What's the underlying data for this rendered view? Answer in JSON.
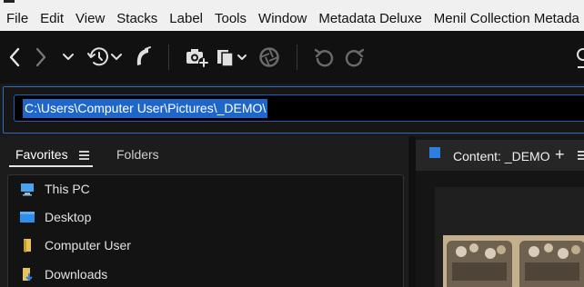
{
  "menubar": {
    "items": [
      "File",
      "Edit",
      "View",
      "Stacks",
      "Label",
      "Tools",
      "Window",
      "Metadata Deluxe",
      "Menil Collection Metada"
    ]
  },
  "toolbar": {
    "buttons": [
      {
        "name": "back-button",
        "icon": "chevron-left-icon"
      },
      {
        "name": "forward-button",
        "icon": "chevron-right-icon"
      },
      {
        "name": "recent-folders-button",
        "icon": "chevron-down-icon"
      },
      {
        "name": "history-button",
        "icon": "history-clock-icon"
      },
      {
        "name": "boomerang-button",
        "icon": "boomerang-icon"
      },
      {
        "name": "get-photos-button",
        "icon": "camera-add-icon"
      },
      {
        "name": "refine-button",
        "icon": "copy-stack-icon"
      },
      {
        "name": "open-in-camera-raw-button",
        "icon": "aperture-icon"
      },
      {
        "name": "rotate-left-button",
        "icon": "rotate-ccw-icon"
      },
      {
        "name": "rotate-right-button",
        "icon": "rotate-cw-icon"
      }
    ]
  },
  "pathbar": {
    "path": "C:\\Users\\Computer User\\Pictures\\_DEMO\\"
  },
  "leftpanel": {
    "tabs": {
      "favorites": "Favorites",
      "folders": "Folders"
    },
    "favorites": [
      {
        "label": "This PC",
        "icon": "computer-icon"
      },
      {
        "label": "Desktop",
        "icon": "desktop-icon"
      },
      {
        "label": "Computer User",
        "icon": "folder-icon"
      },
      {
        "label": "Downloads",
        "icon": "downloads-folder-icon"
      }
    ]
  },
  "content": {
    "tab_label": "Content: _DEMO",
    "add_label": "+"
  },
  "colors": {
    "accent": "#1f66c9",
    "toolbar_bg": "#111111",
    "panel_bg": "#1c1c1c"
  }
}
